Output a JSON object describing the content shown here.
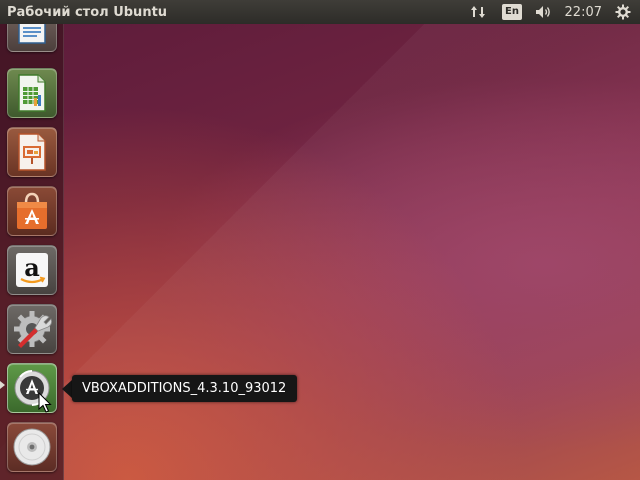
{
  "panel": {
    "window_title": "Рабочий стол Ubuntu",
    "keyboard_layout": "En",
    "clock": "22:07",
    "icons": {
      "network": "network-updown-icon",
      "volume": "speaker-volume-icon",
      "session": "gear-power-icon"
    }
  },
  "launcher": {
    "items": [
      {
        "name": "libreoffice-writer",
        "icon": "writer-document-icon"
      },
      {
        "name": "libreoffice-calc",
        "icon": "calc-spreadsheet-icon"
      },
      {
        "name": "libreoffice-impress",
        "icon": "impress-presentation-icon"
      },
      {
        "name": "ubuntu-software-center",
        "icon": "shopping-bag-a-icon"
      },
      {
        "name": "amazon",
        "icon": "amazon-logo-icon"
      },
      {
        "name": "system-settings",
        "icon": "settings-wrench-icon"
      },
      {
        "name": "vboxadditions-disc",
        "icon": "install-disc-icon",
        "active": true
      },
      {
        "name": "dvd-drive",
        "icon": "dvd-disc-icon"
      }
    ]
  },
  "tooltip": {
    "text": "VBOXADDITIONS_4.3.10_93012"
  },
  "colors": {
    "panel": "#2d2c28",
    "panel_text": "#dfdbd2",
    "tooltip_bg": "#161616",
    "wallpaper_dark": "#5b1b3a",
    "wallpaper_warm": "#b3503e"
  }
}
